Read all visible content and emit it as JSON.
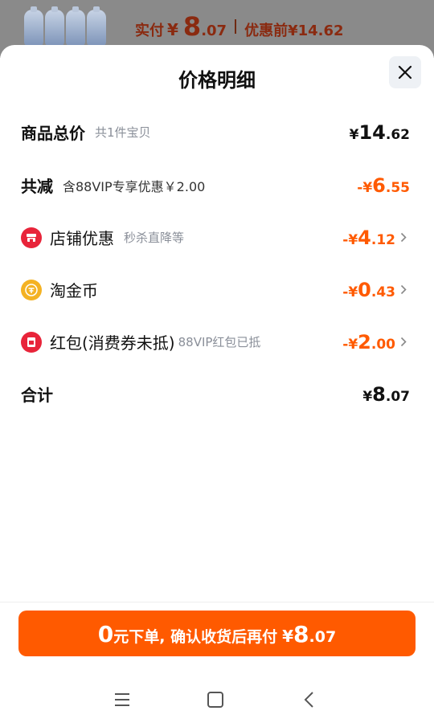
{
  "banner": {
    "paid_label": "实付",
    "currency": "¥",
    "paid_int": "8",
    "paid_dec": ".07",
    "before_label": "优惠前",
    "before_value": "¥14.62"
  },
  "sheet": {
    "title": "价格明细",
    "close_icon": "close-icon"
  },
  "rows": {
    "total": {
      "label": "商品总价",
      "sub": "共1件宝贝",
      "cur": "¥",
      "int": "14",
      "dec": ".62"
    },
    "reduce": {
      "label": "共减",
      "sub": "含88VIP专享优惠￥2.00",
      "cur": "-¥",
      "int": "6",
      "dec": ".55"
    },
    "shop": {
      "label": "店铺优惠",
      "sub": "秒杀直降等",
      "cur": "-¥",
      "int": "4",
      "dec": ".12",
      "icon": "shop-icon"
    },
    "coin": {
      "label": "淘金币",
      "sub": "",
      "cur": "-¥",
      "int": "0",
      "dec": ".43",
      "icon": "coin-icon"
    },
    "redpacket": {
      "label": "红包(消费券未抵)",
      "sub": "88VIP红包已抵",
      "cur": "-¥",
      "int": "2",
      "dec": ".00",
      "icon": "red-packet-icon"
    },
    "sum": {
      "label": "合计",
      "cur": "¥",
      "int": "8",
      "dec": ".07"
    }
  },
  "pay_button": {
    "zero": "0",
    "text": "元下单, 确认收货后再付",
    "cur": "¥",
    "int": "8",
    "dec": ".07"
  },
  "colors": {
    "accent": "#ff5a00",
    "shop_icon": "#e8243a",
    "coin_icon": "#f4b223"
  }
}
